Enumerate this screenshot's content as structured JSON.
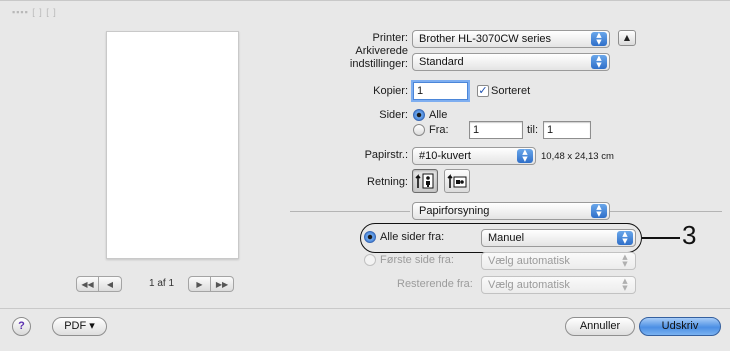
{
  "toolbar_faint": "▪▪▪▪  [          ]  [       ]",
  "preview": {
    "pager_buttons": [
      "◀◀",
      "◀",
      "▶",
      "▶▶"
    ],
    "page_label": "1 af 1"
  },
  "printer": {
    "label": "Printer:",
    "value": "Brother HL-3070CW series",
    "expand_icon": "▲"
  },
  "presets": {
    "label": "Arkiverede\nindstillinger:",
    "value": "Standard"
  },
  "copies": {
    "label": "Kopier:",
    "value": "1",
    "collate_label": "Sorteret",
    "collate_checked": true
  },
  "pages": {
    "label": "Sider:",
    "all_label": "Alle",
    "from_label": "Fra:",
    "from_value": "1",
    "to_label": "til:",
    "to_value": "1"
  },
  "paper": {
    "label": "Papirstr.:",
    "value": "#10-kuvert",
    "size_text": "10,48 x 24,13 cm"
  },
  "orientation": {
    "label": "Retning:"
  },
  "panel_select": {
    "value": "Papirforsyning"
  },
  "feed": {
    "all_pages_label": "Alle sider fra:",
    "all_pages_value": "Manuel",
    "first_page_label": "Første side fra:",
    "first_page_value": "Vælg automatisk",
    "remaining_label": "Resterende fra:",
    "remaining_value": "Vælg automatisk"
  },
  "callout": {
    "number": "3"
  },
  "footer": {
    "help_label": "?",
    "pdf_label": "PDF ▾",
    "cancel_label": "Annuller",
    "print_label": "Udskriv"
  },
  "colors": {
    "accent": "#3b7fd9",
    "default_button": "#4c8fe4",
    "dialog_bg": "#e8e8e8"
  }
}
